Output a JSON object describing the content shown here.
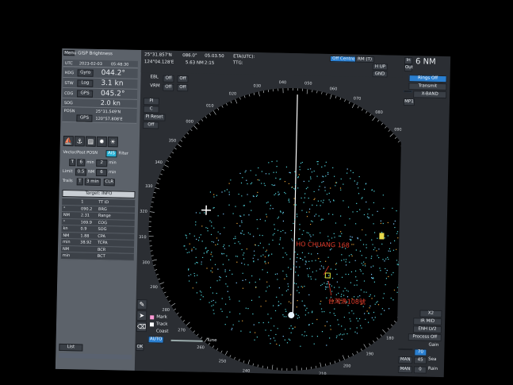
{
  "topbar": {
    "menu": "Menu",
    "brightness": "GISP Brightness",
    "cursor_lat": "25°31.857'N",
    "cursor_rng": "086.0°",
    "cursor_brg": "05.03.50",
    "eta": "ETA(UTC):",
    "ttg": "TTG:",
    "ttg_val": "2:15",
    "cursor_lon": "124°04.128'E",
    "vrm_dist": "5.63 NM",
    "off_centre": "Off Centre",
    "rm_t": "RM (T)",
    "range_label": "6 NM",
    "in": "In",
    "out": "Out",
    "hup": "H UP",
    "gnd": "GND"
  },
  "left_panel": {
    "utc_label": "UTC",
    "date": "2023-02-03",
    "time": "05:48:30",
    "hdg_label": "HDG",
    "gyro": "Gyro",
    "hdg_val": "044.2°",
    "stw_label": "STW",
    "log": "Log",
    "stw_val": "3.1 kn",
    "cog_label": "COG",
    "gps": "GPS",
    "cog_val": "045.2°",
    "sog_label": "SOG",
    "sog_val": "2.0 kn",
    "posn_label": "POSN",
    "lat": "25°31.549'N",
    "lon": "120°57.808'E",
    "gps2": "GPS",
    "vector_past": "Vector/Past POSN",
    "ais": "AIS",
    "filter": "Filter",
    "vec_t": "T",
    "vec_6": "6",
    "vec_min": "min",
    "past_2": "2",
    "past_min": "min",
    "limit": "Limit",
    "limit_val": "0.5",
    "nm": "NM",
    "six": "6",
    "min": "min",
    "trails": "Trails",
    "trails_t": "T",
    "trails_val": "3 min",
    "clr": "CLR",
    "target_label": "Target: INFO",
    "table": [
      [
        "TT ID",
        "1",
        ""
      ],
      [
        "BRG",
        "090.2",
        "°"
      ],
      [
        "Range",
        "2.31",
        "NM"
      ],
      [
        "COG",
        "169.9",
        "°"
      ],
      [
        "SOG",
        "0.9",
        "kn"
      ],
      [
        "CPA",
        "1.88",
        "NM"
      ],
      [
        "TCPA",
        "38.92",
        "min"
      ],
      [
        "BCR",
        "",
        "NM"
      ],
      [
        "BCT",
        "",
        "min"
      ]
    ]
  },
  "radar": {
    "ebl": "EBL",
    "ebl_off": "Off",
    "vrm": "VRM",
    "vrm_off": "Off",
    "pi": "PI",
    "c": "C",
    "pi_reset": "PI Reset",
    "off": "Off",
    "bearing_labels": [
      "000",
      "010",
      "020",
      "030",
      "040",
      "050",
      "060",
      "070",
      "080",
      "090",
      "100",
      "110",
      "120",
      "130",
      "140",
      "150",
      "160",
      "170",
      "180",
      "190",
      "200",
      "210",
      "220",
      "230",
      "240",
      "250",
      "260",
      "270",
      "280",
      "290",
      "300",
      "310",
      "320",
      "330",
      "340",
      "350"
    ],
    "target1": "HO CHUANG 168",
    "target2": "台灣漁108號"
  },
  "right_panel": {
    "rings_off": "Rings Off",
    "transmit": "Transmit",
    "x_band": "X-BAND",
    "mp": "MP1",
    "x2": "X2",
    "ir_mid": "IR MID",
    "enh_lv2": "ENH LV2",
    "process_off": "Process Off",
    "gain": "Gain",
    "gain_val": "70",
    "sea": "Sea",
    "sea_val": "45",
    "man": "MAN",
    "rain": "Rain",
    "rain_val": "0",
    "man2": "MAN"
  },
  "bottom": {
    "list": "List",
    "mark": "Mark",
    "track": "Track",
    "coast": "Coast",
    "auto": "AUTO",
    "tune": "Tune",
    "ok": "OK"
  }
}
